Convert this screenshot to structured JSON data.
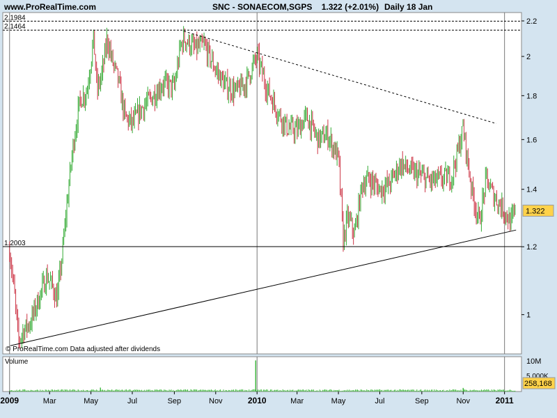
{
  "header": {
    "site": "www.ProRealTime.com",
    "title": "SNC - SONAECOM,SGPS",
    "quote": "1.322 (+2.01%)",
    "period": "Daily  18 Jan"
  },
  "chart_data": {
    "type": "candlestick",
    "symbol": "SNC - SONAECOM,SGPS",
    "last_price": "1.322",
    "watermark": "© ProRealTime.com  Data adjusted after dividends",
    "y_scale": "log",
    "ylim": [
      0.9,
      2.25
    ],
    "yticks": [
      "1",
      "1.2",
      "1.4",
      "1.6",
      "1.8",
      "2",
      "2.2"
    ],
    "xticks": [
      "2009",
      "Mar",
      "May",
      "Jul",
      "Sep",
      "Nov",
      "2010",
      "Mar",
      "May",
      "Jul",
      "Sep",
      "Nov",
      "2011"
    ],
    "xtick_year_flags": [
      true,
      false,
      false,
      false,
      false,
      false,
      true,
      false,
      false,
      false,
      false,
      false,
      true
    ],
    "levels": [
      {
        "label": "2.1984",
        "value": 2.1984,
        "style": "dotted"
      },
      {
        "label": "2.1464",
        "value": 2.1464,
        "style": "dotted"
      },
      {
        "label": "1.2003",
        "value": 1.2003,
        "style": "solid"
      }
    ],
    "trendlines": [
      {
        "from": [
          "2009-01-02",
          0.92
        ],
        "to": [
          "2011-01-18",
          1.255
        ],
        "style": "solid"
      },
      {
        "from": [
          "2009-09-15",
          2.14
        ],
        "to": [
          "2010-12-20",
          1.67
        ],
        "style": "dotted"
      }
    ],
    "price_path": [
      [
        "2009-01-01",
        1.19
      ],
      [
        "2009-01-08",
        1.06
      ],
      [
        "2009-01-14",
        0.93
      ],
      [
        "2009-01-22",
        0.96
      ],
      [
        "2009-02-01",
        0.98
      ],
      [
        "2009-02-14",
        1.05
      ],
      [
        "2009-02-25",
        1.11
      ],
      [
        "2009-03-05",
        1.08
      ],
      [
        "2009-03-12",
        1.04
      ],
      [
        "2009-03-20",
        1.18
      ],
      [
        "2009-03-28",
        1.38
      ],
      [
        "2009-04-05",
        1.58
      ],
      [
        "2009-04-15",
        1.78
      ],
      [
        "2009-04-25",
        1.82
      ],
      [
        "2009-05-01",
        1.98
      ],
      [
        "2009-05-05",
        2.1
      ],
      [
        "2009-05-10",
        1.82
      ],
      [
        "2009-05-18",
        1.92
      ],
      [
        "2009-05-25",
        2.1
      ],
      [
        "2009-06-01",
        1.98
      ],
      [
        "2009-06-10",
        1.88
      ],
      [
        "2009-06-20",
        1.7
      ],
      [
        "2009-07-01",
        1.67
      ],
      [
        "2009-07-15",
        1.74
      ],
      [
        "2009-08-01",
        1.8
      ],
      [
        "2009-08-15",
        1.86
      ],
      [
        "2009-09-01",
        1.84
      ],
      [
        "2009-09-10",
        2.05
      ],
      [
        "2009-09-15",
        2.1
      ],
      [
        "2009-10-01",
        2.04
      ],
      [
        "2009-10-15",
        2.06
      ],
      [
        "2009-11-01",
        1.93
      ],
      [
        "2009-11-15",
        1.85
      ],
      [
        "2009-12-01",
        1.82
      ],
      [
        "2009-12-15",
        1.86
      ],
      [
        "2010-01-01",
        2.0
      ],
      [
        "2010-01-15",
        1.84
      ],
      [
        "2010-02-01",
        1.72
      ],
      [
        "2010-02-15",
        1.65
      ],
      [
        "2010-03-01",
        1.64
      ],
      [
        "2010-03-15",
        1.7
      ],
      [
        "2010-04-01",
        1.6
      ],
      [
        "2010-04-15",
        1.62
      ],
      [
        "2010-05-01",
        1.52
      ],
      [
        "2010-05-08",
        1.22
      ],
      [
        "2010-05-15",
        1.3
      ],
      [
        "2010-05-25",
        1.24
      ],
      [
        "2010-06-05",
        1.42
      ],
      [
        "2010-06-15",
        1.44
      ],
      [
        "2010-07-01",
        1.4
      ],
      [
        "2010-07-15",
        1.42
      ],
      [
        "2010-08-01",
        1.5
      ],
      [
        "2010-08-15",
        1.47
      ],
      [
        "2010-09-01",
        1.45
      ],
      [
        "2010-09-15",
        1.43
      ],
      [
        "2010-10-01",
        1.44
      ],
      [
        "2010-10-15",
        1.45
      ],
      [
        "2010-10-25",
        1.56
      ],
      [
        "2010-11-01",
        1.65
      ],
      [
        "2010-11-08",
        1.5
      ],
      [
        "2010-11-15",
        1.38
      ],
      [
        "2010-11-25",
        1.28
      ],
      [
        "2010-12-05",
        1.44
      ],
      [
        "2010-12-15",
        1.38
      ],
      [
        "2011-01-01",
        1.32
      ],
      [
        "2011-01-10",
        1.28
      ],
      [
        "2011-01-18",
        1.322
      ]
    ],
    "volume": {
      "label": "Volume",
      "last": "258,168",
      "yticks": [
        "10M",
        "5.000K"
      ],
      "spikes": [
        [
          "2009-12-30",
          9.5
        ],
        [
          "2009-05-15",
          1.2
        ],
        [
          "2010-11-01",
          1.1
        ]
      ]
    }
  },
  "colors": {
    "up": "#33aa33",
    "down": "#cc3344",
    "volume": "#44bb44",
    "background": "#ffffff",
    "frame": "#d4e4f0",
    "price_tag": "#ffd24a"
  }
}
